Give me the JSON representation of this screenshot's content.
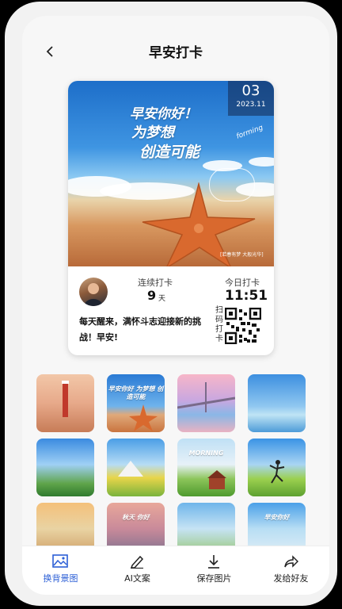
{
  "header": {
    "title": "早安打卡"
  },
  "card": {
    "date_day": "03",
    "date_ym": "2023.11",
    "quote_lines": [
      "早安你好！",
      "为梦想",
      "创造可能"
    ],
    "script_text": "forming",
    "small_caption": "[若春有梦 大般光华]",
    "consecutive_label": "连续打卡",
    "consecutive_value": "9",
    "consecutive_unit": "天",
    "today_label": "今日打卡",
    "today_time": "11:51",
    "message": "每天醒来，满怀斗志迎接新的挑战！早安!",
    "scan_label": "扫码打卡"
  },
  "gallery": [
    {
      "text": ""
    },
    {
      "text": "早安你好 为梦想 创造可能"
    },
    {
      "text": ""
    },
    {
      "text": ""
    },
    {
      "text": ""
    },
    {
      "text": ""
    },
    {
      "text": "MORNING"
    },
    {
      "text": ""
    },
    {
      "text": ""
    },
    {
      "text": "秋天 你好"
    },
    {
      "text": ""
    },
    {
      "text": "早安你好"
    }
  ],
  "bottom_nav": [
    {
      "label": "换背景图",
      "icon": "image-icon",
      "active": true
    },
    {
      "label": "AI文案",
      "icon": "pen-icon",
      "active": false
    },
    {
      "label": "保存图片",
      "icon": "download-icon",
      "active": false
    },
    {
      "label": "发给好友",
      "icon": "share-icon",
      "active": false
    }
  ],
  "colors": {
    "accent": "#2c5fd6",
    "background": "#f7f7f7"
  }
}
